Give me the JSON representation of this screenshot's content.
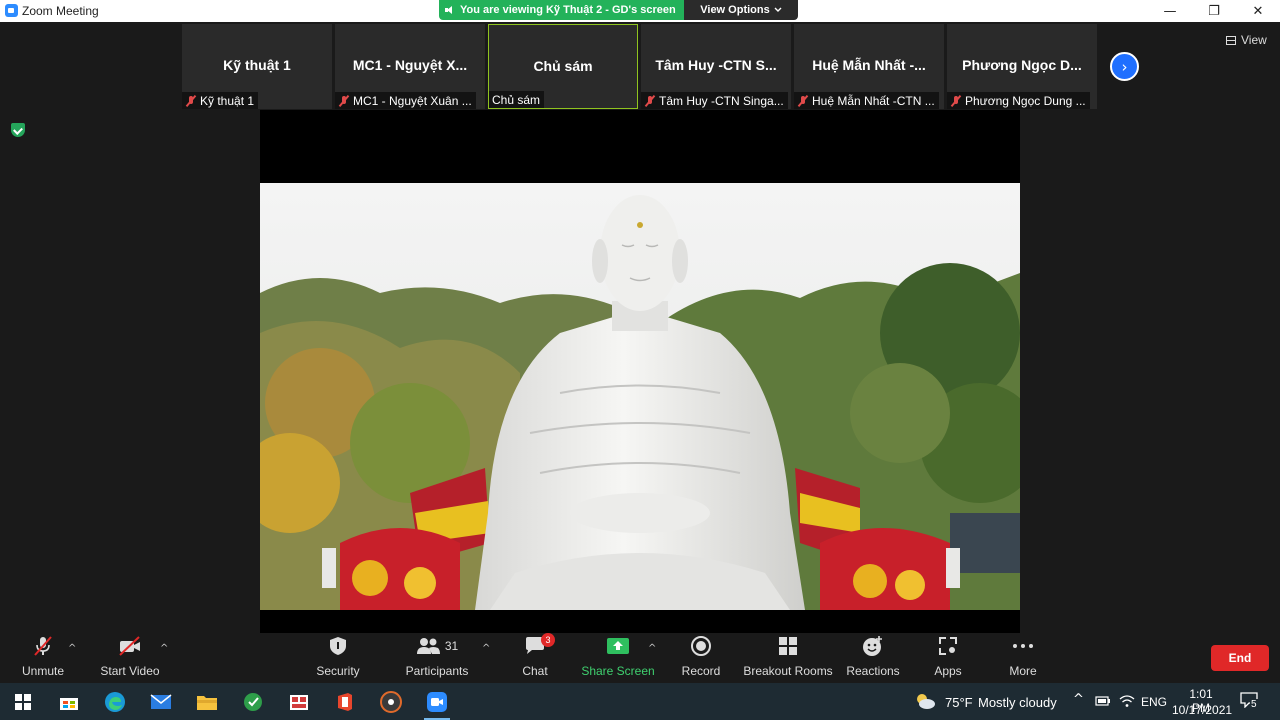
{
  "window": {
    "title": "Zoom Meeting",
    "controls": [
      "—",
      "❐",
      "✕"
    ]
  },
  "share_banner": {
    "text": "You are viewing Kỹ Thuật 2 - GD's screen",
    "view_options": "View Options"
  },
  "top_view_button": "View",
  "thumbnails": [
    {
      "name": "Kỹ thuật 1",
      "label": "Kỹ thuật 1",
      "muted": true,
      "active": false
    },
    {
      "name": "MC1 - Nguyệt X...",
      "label": "MC1 - Nguyệt Xuân ...",
      "muted": true,
      "active": false
    },
    {
      "name": "Chủ sám",
      "label": "Chủ sám",
      "muted": false,
      "active": true
    },
    {
      "name": "Tâm Huy -CTN S...",
      "label": "Tâm Huy -CTN Singa...",
      "muted": true,
      "active": false
    },
    {
      "name": "Huệ Mẫn Nhất -...",
      "label": "Huệ Mẫn Nhất -CTN ...",
      "muted": true,
      "active": false
    },
    {
      "name": "Phương Ngọc D...",
      "label": "Phương Ngọc Dung ...",
      "muted": true,
      "active": false
    }
  ],
  "toolbar": {
    "unmute": "Unmute",
    "start_video": "Start Video",
    "security": "Security",
    "participants": "Participants",
    "participants_count": "31",
    "chat": "Chat",
    "chat_badge": "3",
    "share_screen": "Share Screen",
    "record": "Record",
    "breakout_rooms": "Breakout Rooms",
    "reactions": "Reactions",
    "apps": "Apps",
    "more": "More",
    "end": "End"
  },
  "taskbar": {
    "weather_temp": "75°F",
    "weather_desc": "Mostly cloudy",
    "language": "ENG",
    "time": "1:01 PM",
    "date": "10/17/2021",
    "notifications": "5"
  },
  "colors": {
    "banner_green": "#23b25a",
    "end_red": "#e02828",
    "zoom_blue": "#2d8cff",
    "active_thumb_border": "#8fc31f"
  }
}
